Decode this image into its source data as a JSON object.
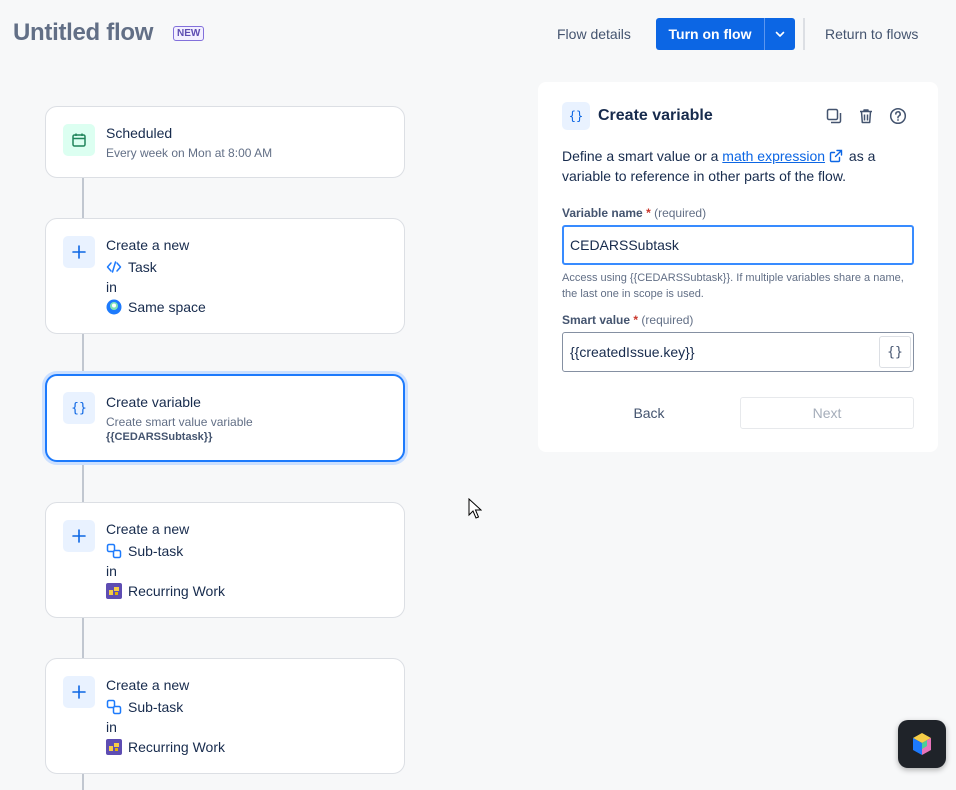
{
  "header": {
    "title": "Untitled flow",
    "badge": "NEW",
    "flow_details": "Flow details",
    "turn_on": "Turn on flow",
    "return": "Return to flows"
  },
  "flow": {
    "trigger": {
      "title": "Scheduled",
      "subtitle": "Every week on Mon at 8:00 AM"
    },
    "step1": {
      "title": "Create a new",
      "type": "Task",
      "in": "in",
      "space": "Same space"
    },
    "step2": {
      "title": "Create variable",
      "subtitle": "Create smart value variable",
      "variable": "{{CEDARSSubtask}}"
    },
    "step3": {
      "title": "Create a new",
      "type": "Sub-task",
      "in": "in",
      "space": "Recurring Work"
    },
    "step4": {
      "title": "Create a new",
      "type": "Sub-task",
      "in": "in",
      "space": "Recurring Work"
    }
  },
  "panel": {
    "title": "Create variable",
    "desc_before": "Define a smart value or a ",
    "desc_link": "math expression",
    "desc_after": " as a variable to reference in other parts of the flow.",
    "var_label": "Variable name",
    "required_mark": "*",
    "required_text": "(required)",
    "var_value": "CEDARSSubtask",
    "hint": "Access using {{CEDARSSubtask}}. If multiple variables share a name, the last one in scope is used.",
    "smart_label": "Smart value",
    "smart_value": "{{createdIssue.key}}",
    "smart_btn": "{}",
    "back": "Back",
    "next": "Next"
  },
  "colors": {
    "primary": "#0c66e4",
    "selected_border": "#1d7afc",
    "required": "#c9372c"
  }
}
